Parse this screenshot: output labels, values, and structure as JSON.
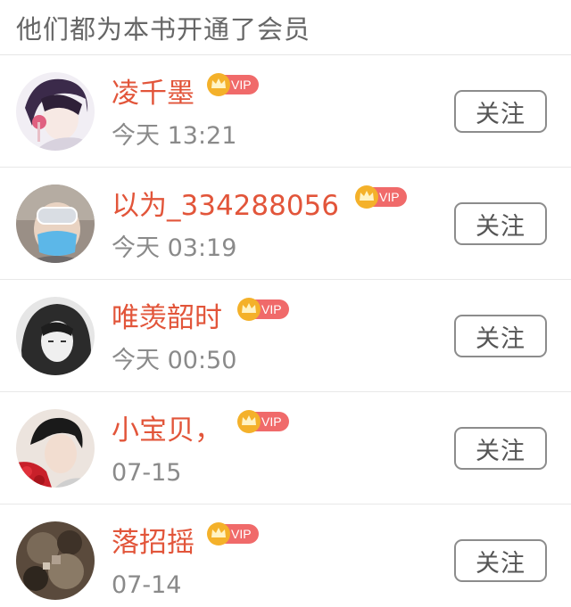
{
  "header": {
    "title": "他们都为本书开通了会员"
  },
  "members": [
    {
      "name": "凌千墨",
      "time": "今天 13:21",
      "vip": "VIP",
      "follow": "关注"
    },
    {
      "name": "以为_334288056",
      "time": "今天 03:19",
      "vip": "VIP",
      "follow": "关注"
    },
    {
      "name": "唯羡韶时",
      "time": "今天 00:50",
      "vip": "VIP",
      "follow": "关注"
    },
    {
      "name": "小宝贝，",
      "time": "07-15",
      "vip": "VIP",
      "follow": "关注"
    },
    {
      "name": "落招摇",
      "time": "07-14",
      "vip": "VIP",
      "follow": "关注"
    }
  ],
  "colors": {
    "name": "#e2553a",
    "vip_badge": "#f06a6a",
    "crown": "#f4b12a",
    "time": "#8a8a8a",
    "button_border": "#8c8c8c"
  },
  "icons": [
    "crown-icon",
    "avatar"
  ]
}
